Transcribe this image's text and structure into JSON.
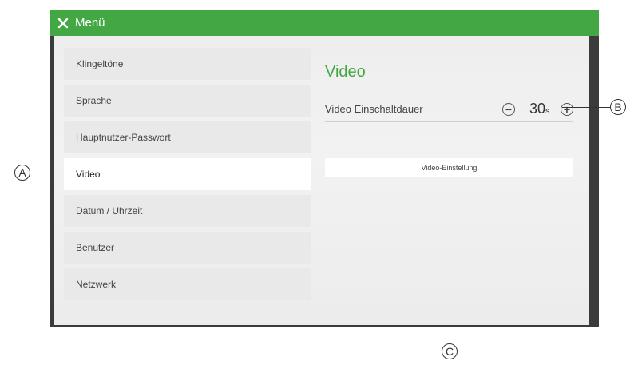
{
  "header": {
    "title": "Menü",
    "close_icon": "close-icon"
  },
  "menu": {
    "items": [
      {
        "label": "Klingeltöne"
      },
      {
        "label": "Sprache"
      },
      {
        "label": "Hauptnutzer-Passwort"
      },
      {
        "label": "Video"
      },
      {
        "label": "Datum / Uhrzeit"
      },
      {
        "label": "Benutzer"
      },
      {
        "label": "Netzwerk"
      }
    ],
    "active_index": 3
  },
  "panel": {
    "title": "Video",
    "row_label": "Video Einschaltdauer",
    "duration_value": "30",
    "duration_unit": "s",
    "minus_label": "−",
    "plus_label": "+",
    "setting_button_label": "Video-Einstellung"
  },
  "callouts": {
    "a": "A",
    "b": "B",
    "c": "C"
  },
  "colors": {
    "accent": "#43a843",
    "frame": "#3b3b3b"
  }
}
